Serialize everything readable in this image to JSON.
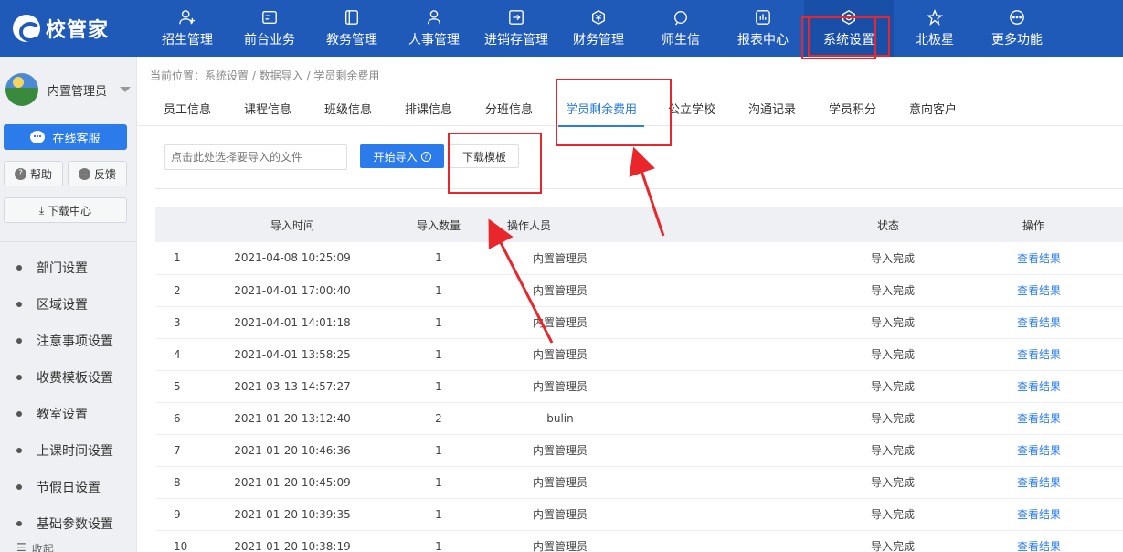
{
  "brand": {
    "name": "校管家"
  },
  "nav": [
    {
      "label": "招生管理",
      "icon": "user-plus-icon"
    },
    {
      "label": "前台业务",
      "icon": "id-card-icon"
    },
    {
      "label": "教务管理",
      "icon": "book-icon"
    },
    {
      "label": "人事管理",
      "icon": "person-icon"
    },
    {
      "label": "进销存管理",
      "icon": "inventory-icon"
    },
    {
      "label": "财务管理",
      "icon": "yuan-icon"
    },
    {
      "label": "师生信",
      "icon": "chat-icon"
    },
    {
      "label": "报表中心",
      "icon": "report-icon"
    },
    {
      "label": "系统设置",
      "icon": "settings-icon",
      "active": true
    },
    {
      "label": "北极星",
      "icon": "star-icon"
    },
    {
      "label": "更多功能",
      "icon": "more-icon"
    }
  ],
  "sidebar": {
    "user_name": "内置管理员",
    "service_label": "在线客服",
    "help_label": "帮助",
    "feedback_label": "反馈",
    "download_label": "下载中心",
    "menu": [
      "部门设置",
      "区域设置",
      "注意事项设置",
      "收费模板设置",
      "教室设置",
      "上课时间设置",
      "节假日设置",
      "基础参数设置"
    ],
    "collapse_label": "收起"
  },
  "breadcrumb": "当前位置：系统设置 / 数据导入 / 学员剩余费用",
  "tabs": [
    "员工信息",
    "课程信息",
    "班级信息",
    "排课信息",
    "分班信息",
    "学员剩余费用",
    "公立学校",
    "沟通记录",
    "学员积分",
    "意向客户"
  ],
  "active_tab": "学员剩余费用",
  "import": {
    "file_placeholder": "点击此处选择要导入的文件",
    "start_label": "开始导入",
    "template_label": "下载模板"
  },
  "table": {
    "headers": [
      "",
      "导入时间",
      "导入数量",
      "操作人员",
      "状态",
      "操作"
    ],
    "rows": [
      {
        "idx": "1",
        "time": "2021-04-08 10:25:09",
        "count": "1",
        "operator": "内置管理员",
        "status": "导入完成",
        "action": "查看结果"
      },
      {
        "idx": "2",
        "time": "2021-04-01 17:00:40",
        "count": "1",
        "operator": "内置管理员",
        "status": "导入完成",
        "action": "查看结果"
      },
      {
        "idx": "3",
        "time": "2021-04-01 14:01:18",
        "count": "1",
        "operator": "内置管理员",
        "status": "导入完成",
        "action": "查看结果"
      },
      {
        "idx": "4",
        "time": "2021-04-01 13:58:25",
        "count": "1",
        "operator": "内置管理员",
        "status": "导入完成",
        "action": "查看结果"
      },
      {
        "idx": "5",
        "time": "2021-03-13 14:57:27",
        "count": "1",
        "operator": "内置管理员",
        "status": "导入完成",
        "action": "查看结果"
      },
      {
        "idx": "6",
        "time": "2021-01-20 13:12:40",
        "count": "2",
        "operator": "bulin",
        "status": "导入完成",
        "action": "查看结果"
      },
      {
        "idx": "7",
        "time": "2021-01-20 10:46:36",
        "count": "1",
        "operator": "内置管理员",
        "status": "导入完成",
        "action": "查看结果"
      },
      {
        "idx": "8",
        "time": "2021-01-20 10:45:09",
        "count": "1",
        "operator": "内置管理员",
        "status": "导入完成",
        "action": "查看结果"
      },
      {
        "idx": "9",
        "time": "2021-01-20 10:39:35",
        "count": "1",
        "operator": "内置管理员",
        "status": "导入完成",
        "action": "查看结果"
      },
      {
        "idx": "10",
        "time": "2021-01-20 10:38:19",
        "count": "1",
        "operator": "内置管理员",
        "status": "导入完成",
        "action": "查看结果"
      }
    ]
  },
  "colors": {
    "nav_bg": "#1f5ab9",
    "accent": "#2b7bea",
    "annotation": "#e8262b"
  }
}
